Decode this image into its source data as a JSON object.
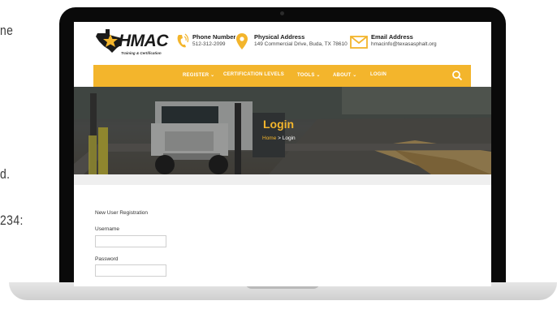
{
  "background_fragments": [
    "ne",
    "d.",
    "234:"
  ],
  "site": {
    "logo": {
      "name": "HMAC",
      "tagline": "Training & Certification"
    },
    "phone": {
      "label": "Phone Number",
      "value": "512-312-2099"
    },
    "address": {
      "label": "Physical Address",
      "value": "149 Commercial Drive, Buda, TX 78610"
    },
    "email": {
      "label": "Email Address",
      "value": "hmacinfo@texasasphalt.org"
    },
    "nav": {
      "items": [
        "REGISTER ⌄",
        "CERTIFICATION LEVELS",
        "TOOLS ⌄",
        "ABOUT ⌄",
        "LOGIN"
      ],
      "search_icon": "search-icon"
    },
    "hero": {
      "title": "Login",
      "breadcrumb_home": "Home",
      "breadcrumb_sep": ">",
      "breadcrumb_current": "Login"
    },
    "form": {
      "title": "New User Registration",
      "username_label": "Username",
      "username_value": "",
      "password_label": "Password",
      "password_value": ""
    }
  },
  "colors": {
    "accent": "#f3b52c",
    "laptop_bezel": "#0a0a0a",
    "text_dark": "#1a1a1a"
  }
}
